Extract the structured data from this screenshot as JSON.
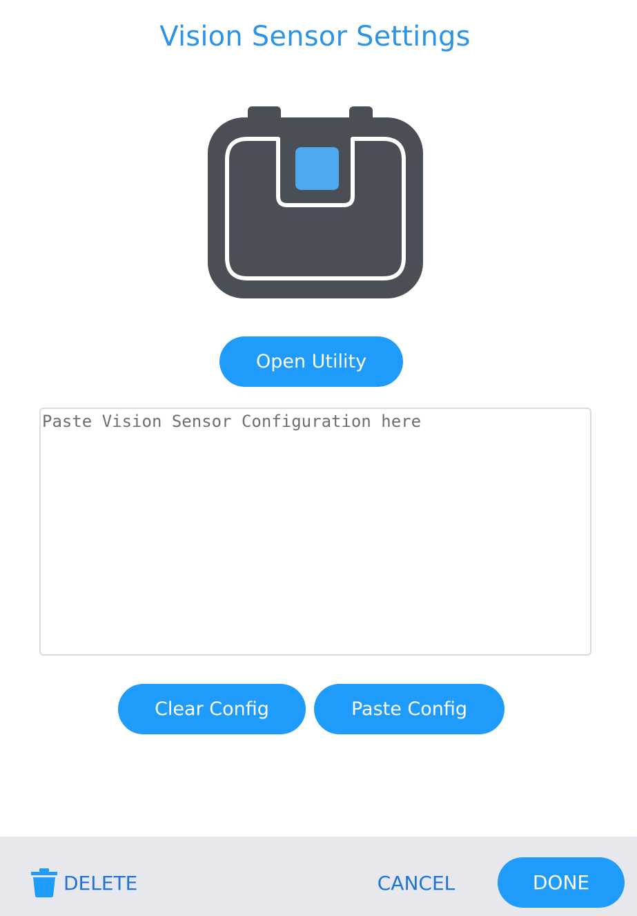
{
  "dialog": {
    "title": "Vision Sensor Settings"
  },
  "device": {
    "icon": "vision-sensor-icon",
    "colors": {
      "body": "#4a4f56",
      "outline": "#ffffff",
      "lens": "#4da8ef"
    }
  },
  "actions": {
    "open_utility_label": "Open Utility",
    "clear_config_label": "Clear Config",
    "paste_config_label": "Paste Config"
  },
  "config": {
    "value": "",
    "placeholder": "Paste Vision Sensor Configuration here"
  },
  "footer": {
    "delete_label": "DELETE",
    "delete_icon": "trash-icon",
    "cancel_label": "CANCEL",
    "done_label": "DONE"
  },
  "colors": {
    "accent": "#1e9bfb",
    "title": "#2b94e8",
    "footer_text": "#1f73d6",
    "footer_bg": "#e6e8ed"
  }
}
